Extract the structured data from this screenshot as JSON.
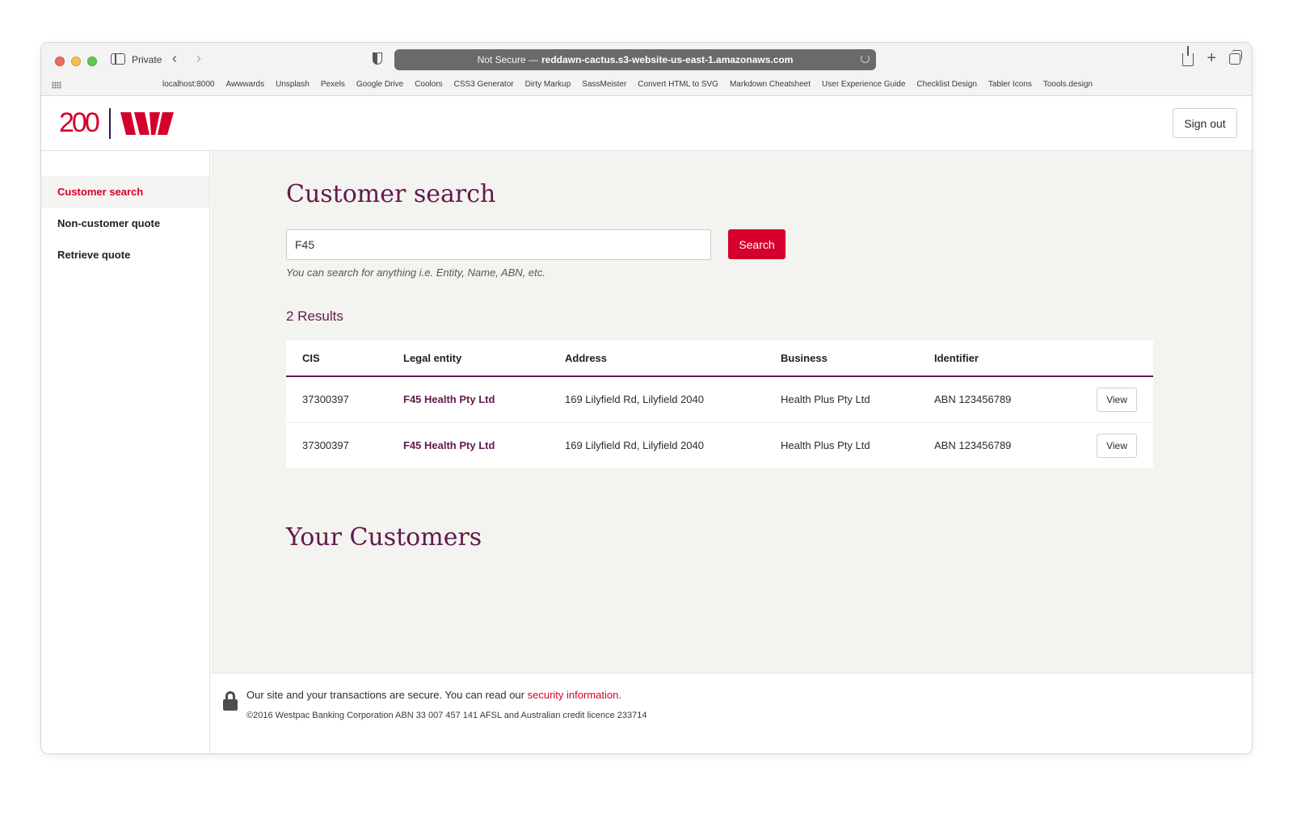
{
  "browser": {
    "private_label": "Private",
    "url_prefix": "Not Secure —",
    "url_host": "reddawn-cactus.s3-website-us-east-1.amazonaws.com",
    "bookmarks": [
      "localhost:8000",
      "Awwwards",
      "Unsplash",
      "Pexels",
      "Google Drive",
      "Coolors",
      "CSS3 Generator",
      "Dirty Markup",
      "SassMeister",
      "Convert HTML to SVG",
      "Markdown Cheatsheet",
      "User Experience Guide",
      "Checklist Design",
      "Tabler Icons",
      "Toools.design"
    ]
  },
  "header": {
    "logo_text": "200",
    "signout_label": "Sign out"
  },
  "nav": {
    "items": [
      {
        "label": "Customer search",
        "active": true
      },
      {
        "label": "Non-customer quote",
        "active": false
      },
      {
        "label": "Retrieve quote",
        "active": false
      }
    ]
  },
  "search": {
    "title": "Customer search",
    "value": "F45",
    "button_label": "Search",
    "hint": "You can search for anything i.e. Entity, Name, ABN, etc."
  },
  "results": {
    "count_label": "2 Results",
    "columns": [
      "CIS",
      "Legal entity",
      "Address",
      "Business",
      "Identifier"
    ],
    "rows": [
      {
        "cis": "37300397",
        "entity": "F45 Health Pty Ltd",
        "address": "169 Lilyfield Rd, Lilyfield 2040",
        "business": "Health Plus Pty Ltd",
        "identifier": "ABN 123456789",
        "action": "View"
      },
      {
        "cis": "37300397",
        "entity": "F45 Health Pty Ltd",
        "address": "169 Lilyfield Rd, Lilyfield 2040",
        "business": "Health Plus Pty Ltd",
        "identifier": "ABN 123456789",
        "action": "View"
      }
    ]
  },
  "customers": {
    "title": "Your Customers"
  },
  "footer": {
    "secure_text": "Our site and your transactions are secure. You can read our",
    "secure_link": "security information",
    "secure_end": ".",
    "copyright": "©2016 Westpac Banking Corporation ABN 33 007 457 141 AFSL and Australian credit licence 233714"
  },
  "colors": {
    "brand_red": "#d5002b",
    "brand_plum": "#621a4b",
    "main_bg": "#f3f3f0"
  }
}
